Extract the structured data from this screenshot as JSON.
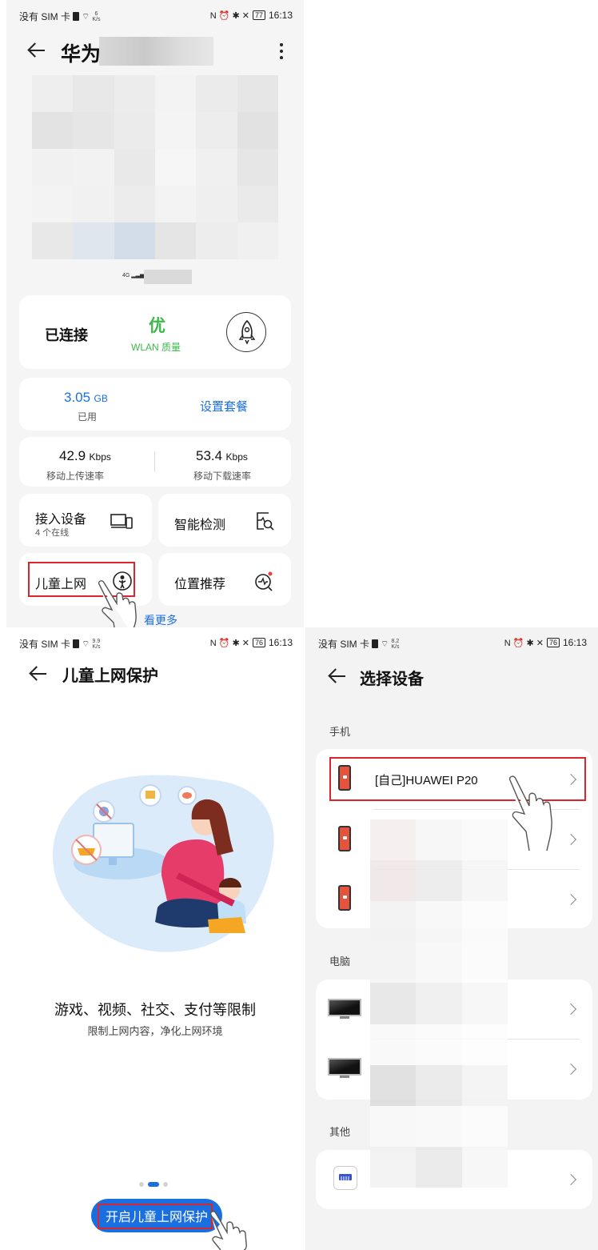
{
  "screen1": {
    "status": {
      "carrier": "没有 SIM 卡",
      "speed_value": "6",
      "speed_unit": "K/s",
      "battery": "77",
      "time": "16:13"
    },
    "title": "华为",
    "signal_label": "4G",
    "connection": {
      "status": "已连接",
      "quality": "优",
      "quality_label": "WLAN 质量"
    },
    "data_usage": {
      "value": "3.05",
      "unit": "GB",
      "label": "已用",
      "plan_button": "设置套餐"
    },
    "upload": {
      "value": "42.9",
      "unit": "Kbps",
      "label": "移动上传速率"
    },
    "download": {
      "value": "53.4",
      "unit": "Kbps",
      "label": "移动下载速率"
    },
    "tiles": {
      "devices": {
        "label": "接入设备",
        "sub": "4 个在线"
      },
      "check": {
        "label": "智能检测"
      },
      "kids": {
        "label": "儿童上网"
      },
      "position": {
        "label": "位置推荐"
      }
    },
    "more_link": "看更多",
    "icons": {
      "back": "back-arrow-icon",
      "menu": "more-vert-icon",
      "boost": "rocket-icon",
      "devices": "devices-icon",
      "check": "diagnose-icon",
      "kids": "child-icon",
      "position": "signal-position-icon"
    },
    "colors": {
      "accent": "#1a6fe0",
      "good": "#3cb94b",
      "highlight": "#d9262c"
    }
  },
  "screen2": {
    "status": {
      "carrier": "没有 SIM 卡",
      "speed_value": "9.9",
      "speed_unit": "K/s",
      "battery": "76",
      "time": "16:13"
    },
    "title": "儿童上网保护",
    "headline": "游戏、视频、社交、支付等限制",
    "subline": "限制上网内容，净化上网环境",
    "page_indicator": {
      "count": 3,
      "active": 1
    },
    "button": "开启儿童上网保护",
    "icons": {
      "back": "back-arrow-icon",
      "illustration": "mother-child-illustration"
    },
    "colors": {
      "button": "#1a6fe0"
    }
  },
  "screen3": {
    "status": {
      "carrier": "没有 SIM 卡",
      "speed_value": "8.2",
      "speed_unit": "K/s",
      "battery": "76",
      "time": "16:13"
    },
    "title": "选择设备",
    "sections": {
      "phone": {
        "label": "手机",
        "first_device": "[自己]HUAWEI P20"
      },
      "pc": {
        "label": "电脑"
      },
      "other": {
        "label": "其他"
      }
    },
    "icons": {
      "back": "back-arrow-icon",
      "phone": "phone-icon",
      "pc": "monitor-icon",
      "router": "router-icon",
      "chevron": "chevron-right-icon"
    }
  }
}
